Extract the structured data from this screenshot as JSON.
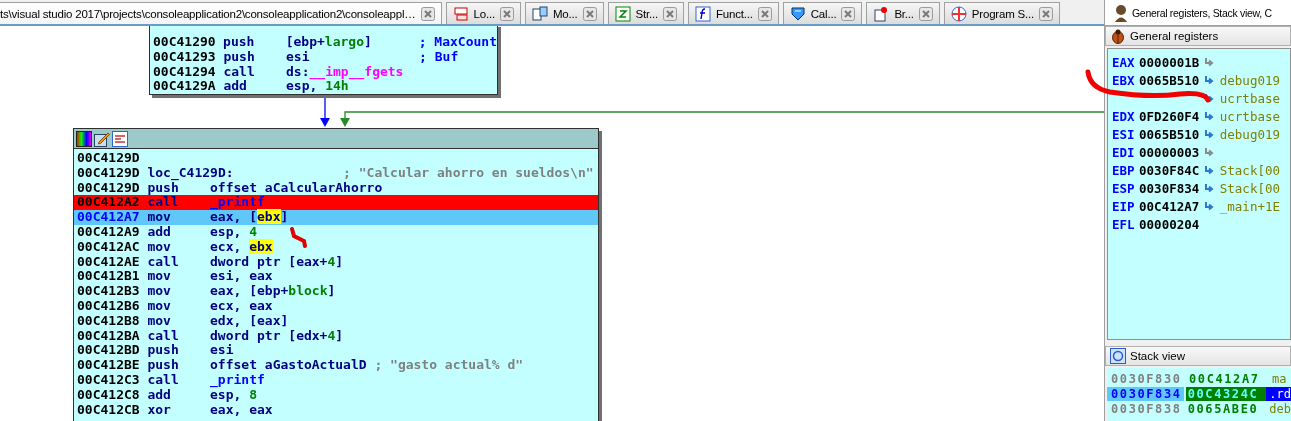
{
  "tabs": [
    {
      "label": "ts\\visual studio 2017\\projects\\consoleapplication2\\consoleapplication2\\consoleappl…",
      "selected": true
    },
    {
      "label": "Lo...",
      "selected": false
    },
    {
      "label": "Mo...",
      "selected": false
    },
    {
      "label": "Str...",
      "selected": false
    },
    {
      "label": "Funct...",
      "selected": false
    },
    {
      "label": "Cal...",
      "selected": false
    },
    {
      "label": "Br...",
      "selected": false
    },
    {
      "label": "Program S...",
      "selected": false
    }
  ],
  "graph": {
    "blocks": [
      {
        "lines": [
          {
            "address": "00C41290",
            "mnemonic": "push",
            "operand": [
              {
                "text": "[ebp+",
                "kind": "plain"
              },
              {
                "text": "largo",
                "kind": "var"
              },
              {
                "text": "]",
                "kind": "plain"
              }
            ],
            "comment": {
              "text": "; MaxCount",
              "kind": "arg"
            },
            "breakpoint": false,
            "current": false
          },
          {
            "address": "00C41293",
            "mnemonic": "push",
            "operand": [
              {
                "text": "esi",
                "kind": "plain"
              }
            ],
            "comment": {
              "text": "; Buf",
              "kind": "arg"
            },
            "breakpoint": false,
            "current": false
          },
          {
            "address": "00C41294",
            "mnemonic": "call",
            "operand": [
              {
                "text": "ds:",
                "kind": "plain"
              },
              {
                "text": "__imp__fgets",
                "kind": "import"
              }
            ],
            "breakpoint": false,
            "current": false
          },
          {
            "address": "00C4129A",
            "mnemonic": "add",
            "operand": [
              {
                "text": "esp, ",
                "kind": "plain"
              },
              {
                "text": "14h",
                "kind": "var"
              }
            ],
            "breakpoint": false,
            "current": false
          }
        ]
      },
      {
        "lines": [
          {
            "address": "00C4129D",
            "breakpoint": false,
            "current": false
          },
          {
            "address": "00C4129D",
            "label": "loc_C4129D:",
            "comment": {
              "text": "; \"Calcular ahorro en sueldos\\n\"",
              "kind": "string"
            },
            "breakpoint": false,
            "current": false
          },
          {
            "address": "00C4129D",
            "mnemonic": "push",
            "operand": [
              {
                "text": "offset aCalcularAhorro",
                "kind": "plain"
              }
            ],
            "breakpoint": false,
            "current": false
          },
          {
            "address": "00C412A2",
            "mnemonic": "call",
            "operand": [
              {
                "text": "_printf",
                "kind": "func"
              }
            ],
            "breakpoint": true,
            "current": false
          },
          {
            "address": "00C412A7",
            "mnemonic": "mov",
            "operand": [
              {
                "text": "eax, [",
                "kind": "plain"
              },
              {
                "text": "ebx",
                "kind": "highlight"
              },
              {
                "text": "]",
                "kind": "plain"
              }
            ],
            "breakpoint": false,
            "current": true
          },
          {
            "address": "00C412A9",
            "mnemonic": "add",
            "operand": [
              {
                "text": "esp, ",
                "kind": "plain"
              },
              {
                "text": "4",
                "kind": "var"
              }
            ],
            "breakpoint": false,
            "current": false
          },
          {
            "address": "00C412AC",
            "mnemonic": "mov",
            "operand": [
              {
                "text": "ecx, ",
                "kind": "plain"
              },
              {
                "text": "ebx",
                "kind": "highlight"
              }
            ],
            "breakpoint": false,
            "current": false
          },
          {
            "address": "00C412AE",
            "mnemonic": "call",
            "operand": [
              {
                "text": "dword ptr [eax+",
                "kind": "plain"
              },
              {
                "text": "4",
                "kind": "var"
              },
              {
                "text": "]",
                "kind": "plain"
              }
            ],
            "breakpoint": false,
            "current": false
          },
          {
            "address": "00C412B1",
            "mnemonic": "mov",
            "operand": [
              {
                "text": "esi, eax",
                "kind": "plain"
              }
            ],
            "breakpoint": false,
            "current": false
          },
          {
            "address": "00C412B3",
            "mnemonic": "mov",
            "operand": [
              {
                "text": "eax, [ebp+",
                "kind": "plain"
              },
              {
                "text": "block",
                "kind": "var"
              },
              {
                "text": "]",
                "kind": "plain"
              }
            ],
            "breakpoint": false,
            "current": false
          },
          {
            "address": "00C412B6",
            "mnemonic": "mov",
            "operand": [
              {
                "text": "ecx, eax",
                "kind": "plain"
              }
            ],
            "breakpoint": false,
            "current": false
          },
          {
            "address": "00C412B8",
            "mnemonic": "mov",
            "operand": [
              {
                "text": "edx, [eax]",
                "kind": "plain"
              }
            ],
            "breakpoint": false,
            "current": false
          },
          {
            "address": "00C412BA",
            "mnemonic": "call",
            "operand": [
              {
                "text": "dword ptr [edx+",
                "kind": "plain"
              },
              {
                "text": "4",
                "kind": "var"
              },
              {
                "text": "]",
                "kind": "plain"
              }
            ],
            "breakpoint": false,
            "current": false
          },
          {
            "address": "00C412BD",
            "mnemonic": "push",
            "operand": [
              {
                "text": "esi",
                "kind": "plain"
              }
            ],
            "breakpoint": false,
            "current": false
          },
          {
            "address": "00C412BE",
            "mnemonic": "push",
            "operand": [
              {
                "text": "offset aGastoActualD",
                "kind": "plain"
              }
            ],
            "comment": {
              "text": "; \"gasto actual% d\"",
              "kind": "string"
            },
            "breakpoint": false,
            "current": false
          },
          {
            "address": "00C412C3",
            "mnemonic": "call",
            "operand": [
              {
                "text": "_printf",
                "kind": "func"
              }
            ],
            "breakpoint": false,
            "current": false
          },
          {
            "address": "00C412C8",
            "mnemonic": "add",
            "operand": [
              {
                "text": "esp, ",
                "kind": "plain"
              },
              {
                "text": "8",
                "kind": "var"
              }
            ],
            "breakpoint": false,
            "current": false
          },
          {
            "address": "00C412CB",
            "mnemonic": "xor",
            "operand": [
              {
                "text": "eax, eax",
                "kind": "plain"
              }
            ],
            "breakpoint": false,
            "current": false
          }
        ]
      }
    ]
  },
  "debug_panel": {
    "title": "General registers, Stack view, C",
    "registers": {
      "title": "General registers",
      "rows": [
        {
          "name": "EAX",
          "value": "0000001B",
          "arrow": true
        },
        {
          "name": "EBX",
          "value": "0065B510",
          "arrow": true,
          "target": "debug019"
        },
        {
          "arrow": true,
          "target": "ucrtbase"
        },
        {
          "name": "EDX",
          "value": "0FD260F4",
          "arrow": true,
          "target": "ucrtbase"
        },
        {
          "name": "ESI",
          "value": "0065B510",
          "arrow": true,
          "target": "debug019"
        },
        {
          "name": "EDI",
          "value": "00000003",
          "arrow": true
        },
        {
          "name": "EBP",
          "value": "0030F84C",
          "arrow": true,
          "target": "Stack[00"
        },
        {
          "name": "ESP",
          "value": "0030F834",
          "arrow": true,
          "target": "Stack[00"
        },
        {
          "name": "EIP",
          "value": "00C412A7",
          "arrow": true,
          "target": "_main+1E"
        },
        {
          "name": "EFL",
          "value": "00000204",
          "arrow": false
        }
      ]
    },
    "stack": {
      "title": "Stack view",
      "rows": [
        {
          "address": "0030F830",
          "value": "00C412A7",
          "target": "ma",
          "selected": false
        },
        {
          "address": "0030F834",
          "value": "00C4324C",
          "target": ".rd",
          "selected": true
        },
        {
          "address": "0030F838",
          "value": "0065ABE0",
          "target": "deb",
          "selected": false
        }
      ]
    }
  }
}
